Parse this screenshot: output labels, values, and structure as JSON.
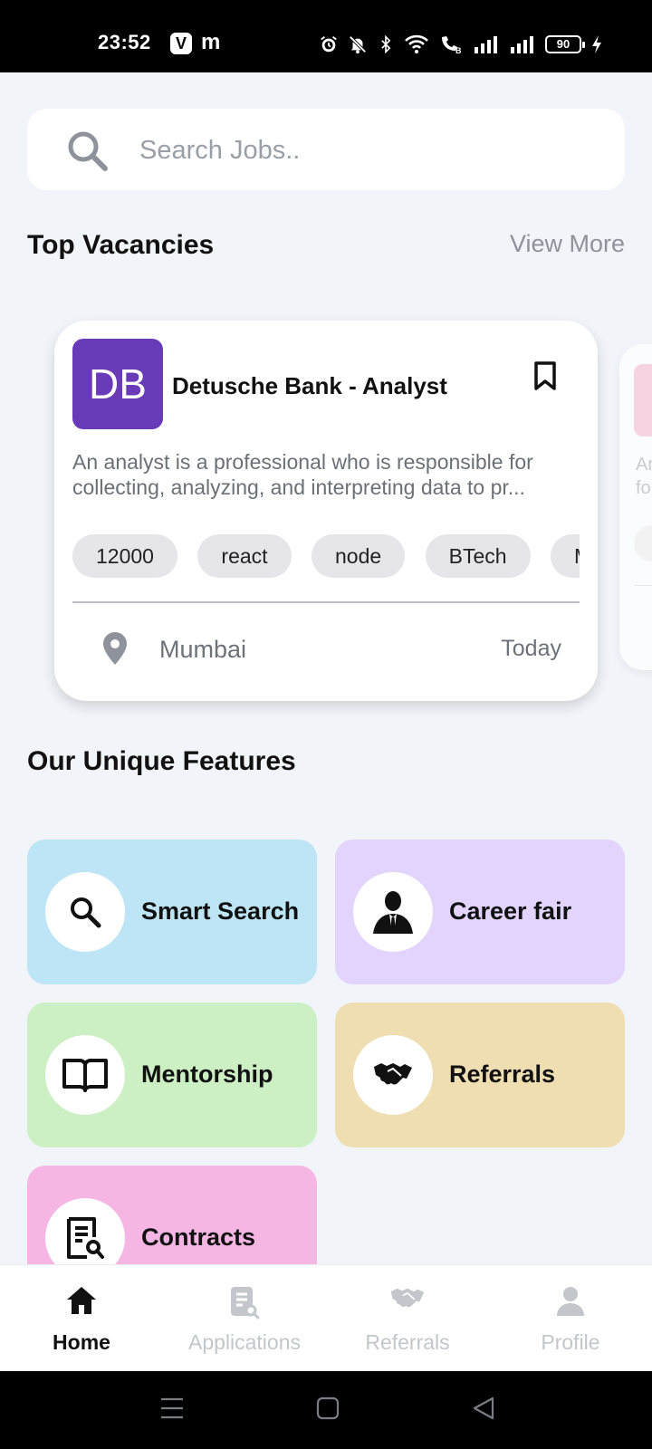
{
  "status_bar": {
    "time": "23:52",
    "app_icon_1": "V",
    "app_icon_2": "m",
    "battery": "90",
    "icons": [
      "alarm-icon",
      "mute-icon",
      "bluetooth-icon",
      "wifi-icon",
      "wifi-call-icon",
      "signal-icon",
      "signal-icon",
      "battery-icon",
      "charging-icon"
    ]
  },
  "search": {
    "placeholder": "Search Jobs.."
  },
  "vacancies": {
    "title": "Top Vacancies",
    "view_more": "View More",
    "cards": [
      {
        "logo_text": "DB",
        "logo_color": "#6a3bb8",
        "title": "Detusche Bank - Analyst",
        "description": "An analyst is a professional who is responsible for collecting, analyzing, and interpreting data to pr...",
        "tags": [
          "12000",
          "react",
          "node",
          "BTech",
          "M"
        ],
        "location": "Mumbai",
        "posted": "Today"
      },
      {
        "description_peek": "Ar fo"
      }
    ]
  },
  "features": {
    "title": "Our Unique Features",
    "items": [
      {
        "label": "Smart Search",
        "icon": "search-icon",
        "color": "#bde5f5"
      },
      {
        "label": "Career fair",
        "icon": "businessman-icon",
        "color": "#e2d4fd"
      },
      {
        "label": "Mentorship",
        "icon": "book-icon",
        "color": "#ccf0c4"
      },
      {
        "label": "Referrals",
        "icon": "handshake-icon",
        "color": "#f0deb3"
      },
      {
        "label": "Contracts",
        "icon": "contract-icon",
        "color": "#f6b6e4"
      }
    ]
  },
  "bottom_nav": {
    "items": [
      {
        "label": "Home",
        "icon": "home-icon",
        "active": true
      },
      {
        "label": "Applications",
        "icon": "applications-icon",
        "active": false
      },
      {
        "label": "Referrals",
        "icon": "handshake-icon",
        "active": false
      },
      {
        "label": "Profile",
        "icon": "person-icon",
        "active": false
      }
    ]
  },
  "system_nav": [
    "menu-icon",
    "home-square-icon",
    "back-icon"
  ]
}
